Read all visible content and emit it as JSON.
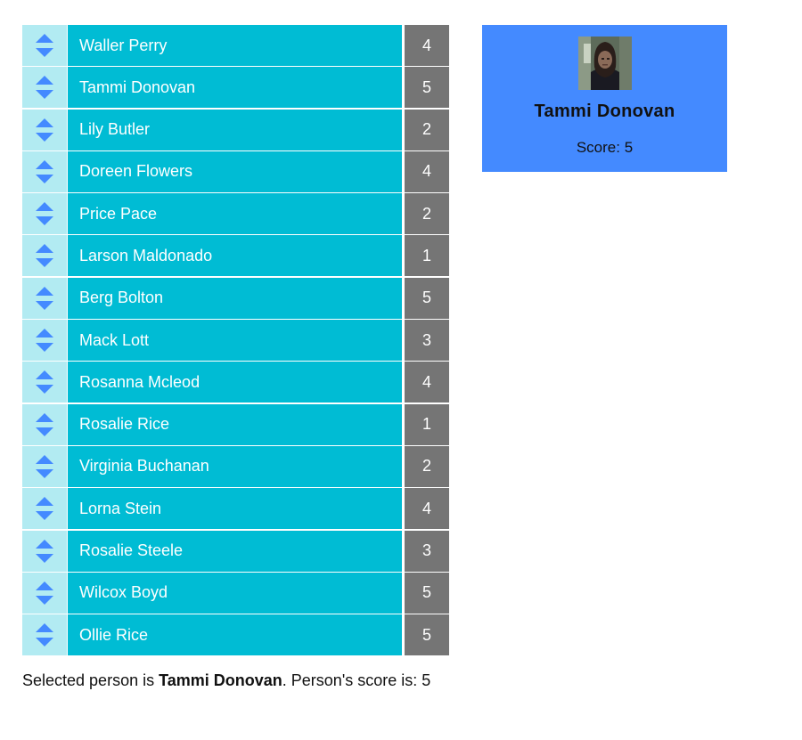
{
  "people": [
    {
      "name": "Waller Perry",
      "score": "4"
    },
    {
      "name": "Tammi Donovan",
      "score": "5"
    },
    {
      "name": "Lily Butler",
      "score": "2"
    },
    {
      "name": "Doreen Flowers",
      "score": "4"
    },
    {
      "name": "Price Pace",
      "score": "2"
    },
    {
      "name": "Larson Maldonado",
      "score": "1"
    },
    {
      "name": "Berg Bolton",
      "score": "5"
    },
    {
      "name": "Mack Lott",
      "score": "3"
    },
    {
      "name": "Rosanna Mcleod",
      "score": "4"
    },
    {
      "name": "Rosalie Rice",
      "score": "1"
    },
    {
      "name": "Virginia Buchanan",
      "score": "2"
    },
    {
      "name": "Lorna Stein",
      "score": "4"
    },
    {
      "name": "Rosalie Steele",
      "score": "3"
    },
    {
      "name": "Wilcox Boyd",
      "score": "5"
    },
    {
      "name": "Ollie Rice",
      "score": "5"
    }
  ],
  "icons": {
    "handle": "drag-sort-icon",
    "avatar": "person-photo"
  },
  "colors": {
    "handle_bg": "#b2ebf2",
    "name_bg": "#00bcd4",
    "score_bg": "#757575",
    "card_bg": "#448aff",
    "arrow": "#448aff"
  },
  "card": {
    "name": "Tammi Donovan",
    "score_text": "Score: 5"
  },
  "status": {
    "prefix": "Selected person is ",
    "name": "Tammi Donovan",
    "suffix": ". Person's score is: 5"
  }
}
